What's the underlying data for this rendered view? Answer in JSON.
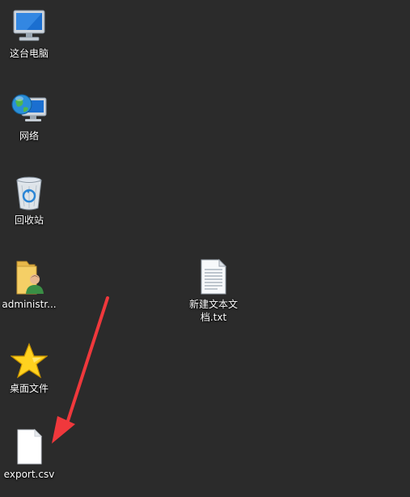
{
  "desktop": {
    "icons": [
      {
        "label": "这台电脑",
        "icon": "computer-icon"
      },
      {
        "label": "网络",
        "icon": "network-icon"
      },
      {
        "label": "回收站",
        "icon": "recycle-bin-icon"
      },
      {
        "label": "administr...",
        "icon": "user-folder-icon"
      },
      {
        "label": "桌面文件",
        "icon": "star-icon"
      },
      {
        "label": "export.csv",
        "icon": "blank-file-icon"
      },
      {
        "label": "新建文本文档.txt",
        "icon": "text-file-icon"
      }
    ]
  },
  "annotation": {
    "icon": "red-arrow-annotation",
    "color": "#f0383c"
  },
  "colors": {
    "background": "#2b2b2b",
    "label": "#ffffff"
  }
}
